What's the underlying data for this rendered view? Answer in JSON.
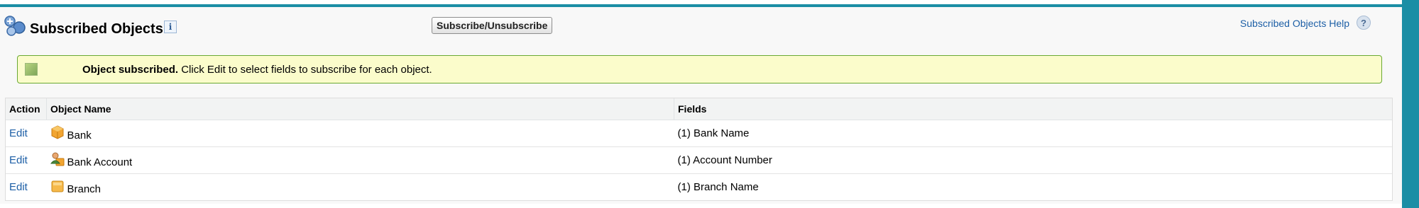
{
  "header": {
    "title": "Subscribed Objects",
    "info_icon": "i",
    "subscribe_button": "Subscribe/Unsubscribe",
    "help_link": "Subscribed Objects Help",
    "help_icon": "?"
  },
  "message": {
    "bold": "Object subscribed.",
    "text": "Click Edit to select fields to subscribe for each object."
  },
  "table": {
    "columns": [
      "Action",
      "Object Name",
      "Fields"
    ],
    "rows": [
      {
        "action": "Edit",
        "object": "Bank",
        "icon": "cube-icon",
        "fields": "(1) Bank Name"
      },
      {
        "action": "Edit",
        "object": "Bank Account",
        "icon": "person-account-icon",
        "fields": "(1) Account Number"
      },
      {
        "action": "Edit",
        "object": "Branch",
        "icon": "folder-icon",
        "fields": "(1) Branch Name"
      }
    ]
  },
  "colors": {
    "accent": "#1b8ea5",
    "link": "#1d5fa6",
    "message_bg": "#fbfccb",
    "message_border": "#6aa933"
  }
}
